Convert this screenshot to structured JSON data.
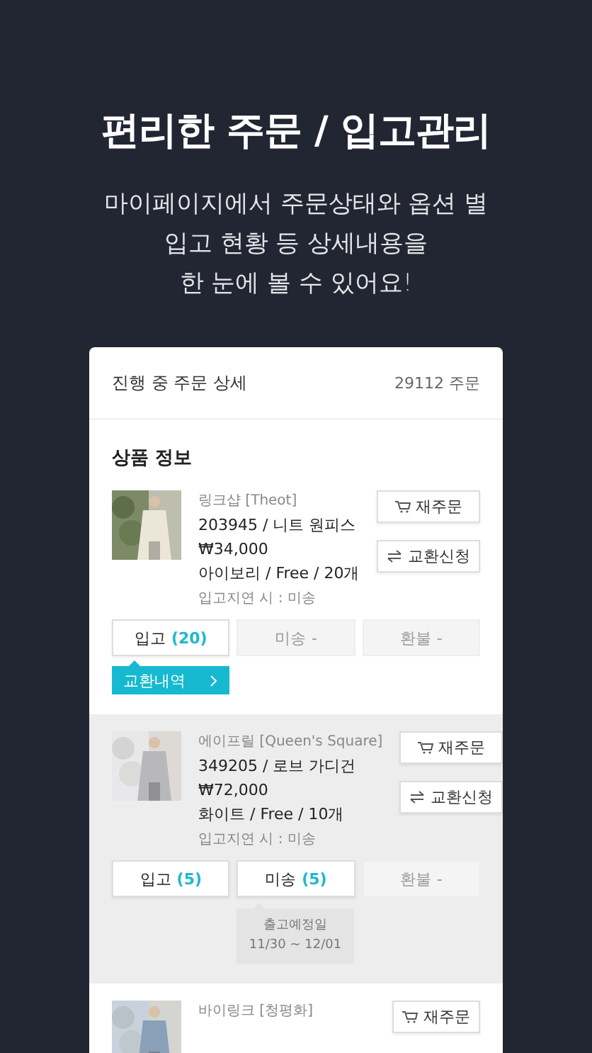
{
  "headline": "편리한 주문 / 입고관리",
  "subtitle": [
    "마이페이지에서 주문상태와 옵션 별",
    "입고 현황 등 상세내용을",
    "한 눈에 볼 수 있어요!"
  ],
  "card": {
    "title": "진행 중 주문 상세",
    "order_count": "29112 주문",
    "section_title": "상품 정보",
    "items": [
      {
        "highlighted": false,
        "image": {
          "kind": "picture"
        },
        "brand": "링크샵 [Theot]",
        "name": "203945 / 니트 원피스",
        "price": "₩34,000",
        "option": "아이보리 / Free / 20개",
        "delay_note": "입고지연 시 : 미송",
        "actions": [
          "재주문",
          "교환신청"
        ],
        "statuses": [
          {
            "label": "입고",
            "count": "(20)",
            "disabled": false
          },
          {
            "label": "미송",
            "count": "-",
            "disabled": true
          },
          {
            "label": "환불",
            "count": "-",
            "disabled": true
          }
        ],
        "exchange_link": "교환내역"
      },
      {
        "highlighted": true,
        "image": {
          "kind": "picture"
        },
        "brand": "에이프릴 [Queen's Square]",
        "name": "349205 / 로브 가디건",
        "price": "₩72,000",
        "option": "화이트 / Free / 10개",
        "delay_note": "입고지연 시 : 미송",
        "actions": [
          "재주문",
          "교환신청"
        ],
        "statuses": [
          {
            "label": "입고",
            "count": "(5)",
            "disabled": false
          },
          {
            "label": "미송",
            "count": "(5)",
            "disabled": false
          },
          {
            "label": "환불",
            "count": "-",
            "disabled": true
          }
        ],
        "tooltip": {
          "title": "출고예정일",
          "dates": "11/30 ~ 12/01"
        }
      },
      {
        "highlighted": false,
        "image": {
          "kind": "picture"
        },
        "brand": "바이링크 [청평화]",
        "actions": [
          "재주문"
        ]
      }
    ]
  }
}
